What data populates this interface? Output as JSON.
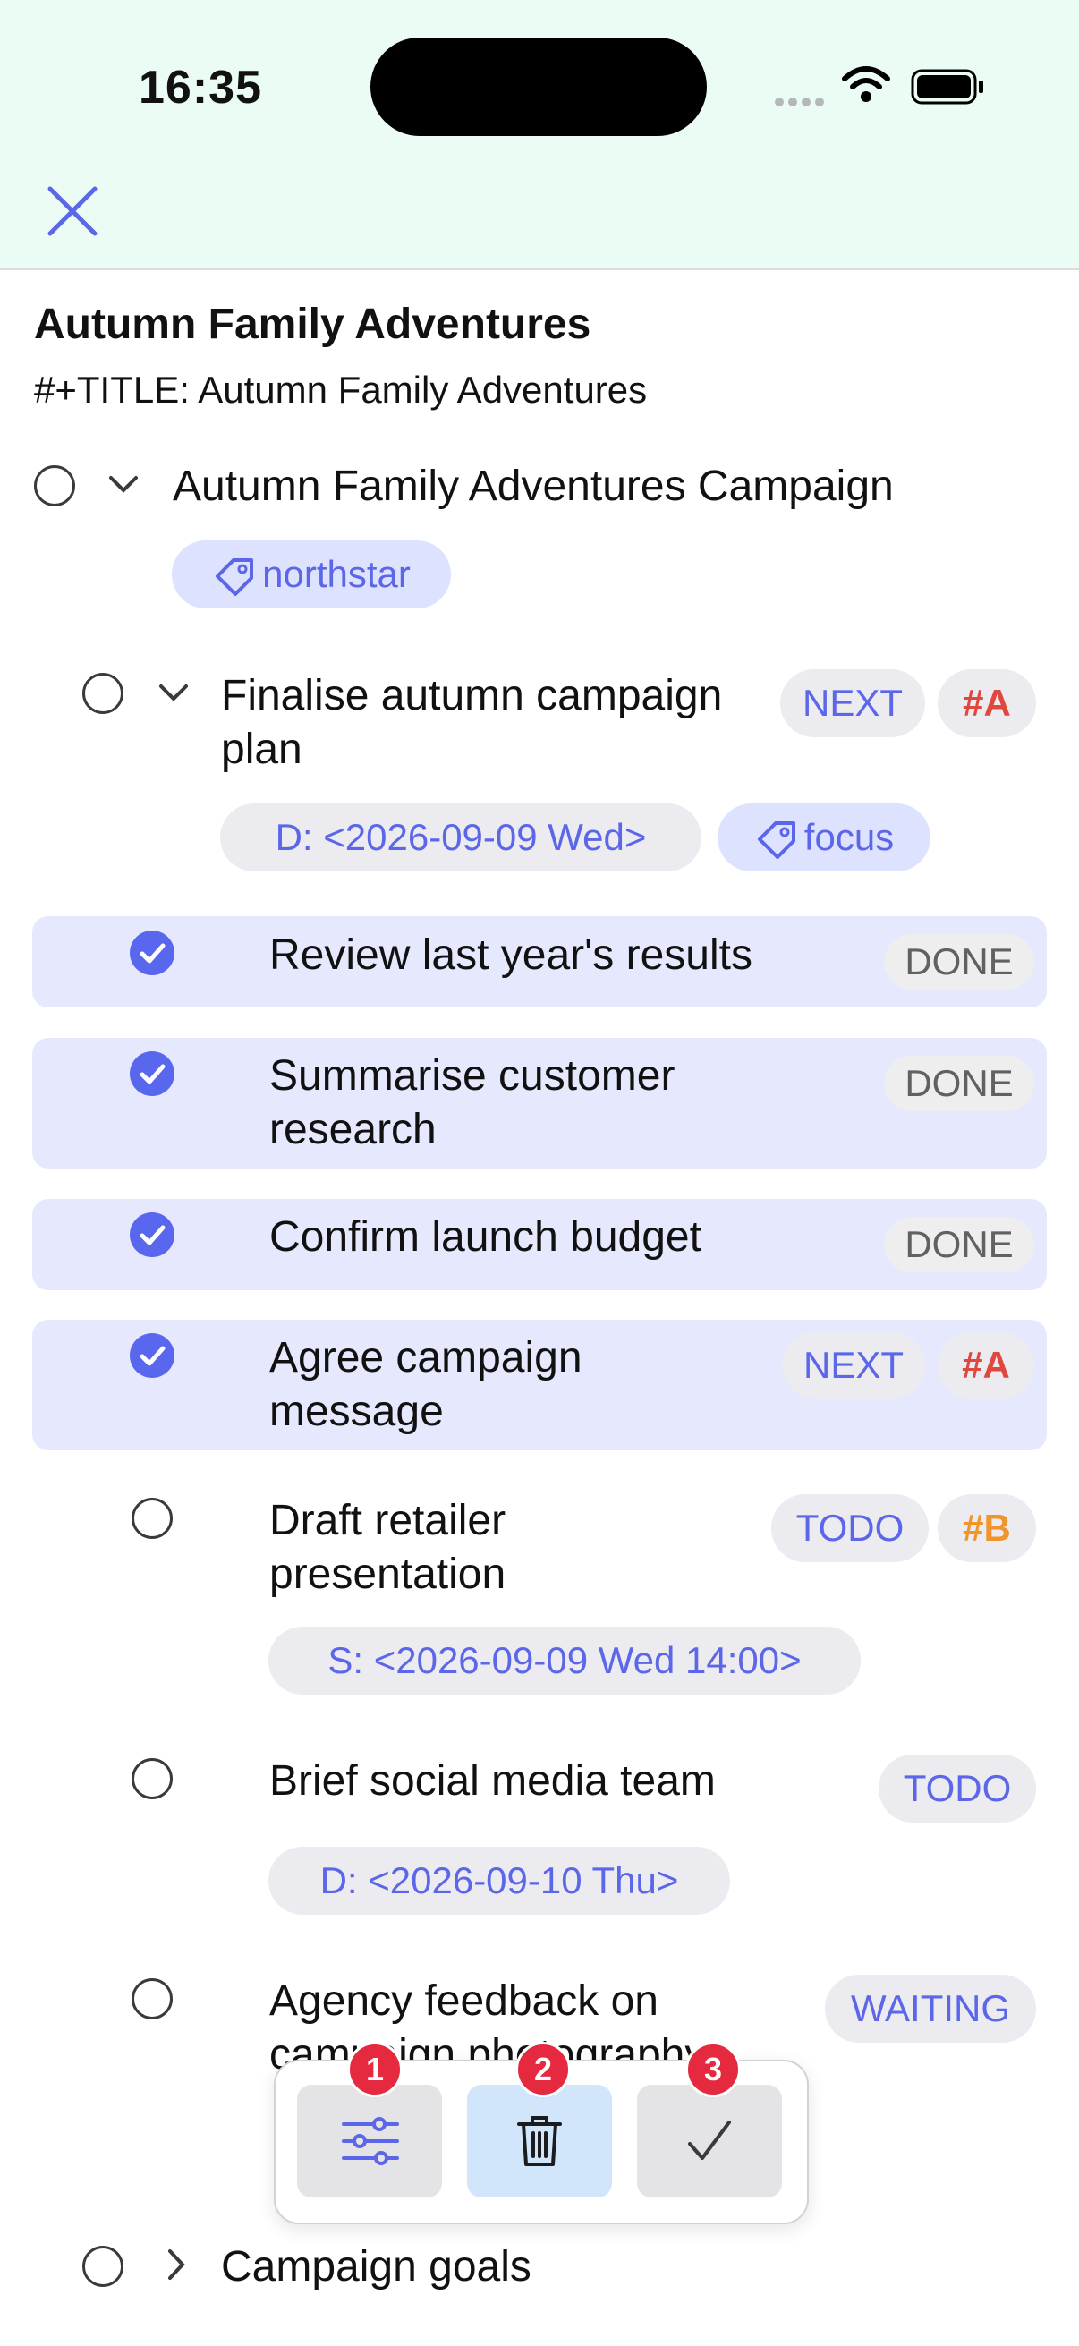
{
  "status_bar": {
    "time": "16:35"
  },
  "document": {
    "title": "Autumn Family Adventures",
    "file_title": "#+TITLE: Autumn Family Adventures"
  },
  "outline": {
    "root": {
      "text": "Autumn Family Adventures Campaign",
      "tag": "northstar"
    },
    "node": {
      "line1": "Finalise autumn campaign",
      "line2": "plan",
      "keyword": "NEXT",
      "priority": "#A",
      "deadline": "D: <2026-09-09 Wed>",
      "tag": "focus"
    },
    "items": [
      {
        "line1": "Review last year's results",
        "line2": "",
        "keyword": "DONE"
      },
      {
        "line1": "Summarise customer",
        "line2": "research",
        "keyword": "DONE"
      },
      {
        "line1": "Confirm launch budget",
        "line2": "",
        "keyword": "DONE"
      },
      {
        "line1": "Agree campaign",
        "line2": "message",
        "keyword": "NEXT",
        "priority": "#A"
      },
      {
        "line1": "Draft retailer",
        "line2": "presentation",
        "keyword": "TODO",
        "priority": "#B",
        "scheduled": "S: <2026-09-09 Wed 14:00>"
      },
      {
        "line1": "Brief social media team",
        "keyword": "TODO",
        "deadline": "D: <2026-09-10 Thu>"
      },
      {
        "line1": "Agency feedback on",
        "line2": "campaign photography",
        "keyword": "WAITING"
      }
    ],
    "collapsed": {
      "text": "Campaign goals"
    }
  },
  "toolbar": {
    "buttons": [
      {
        "icon": "sliders-icon",
        "badge": "1"
      },
      {
        "icon": "trash-icon",
        "badge": "2"
      },
      {
        "icon": "checkmark-icon",
        "badge": "3"
      }
    ]
  },
  "colors": {
    "accent": "#5966ee",
    "highlight": "#e6e9fd",
    "priorityA": "#e0483e",
    "priorityB": "#f0942b",
    "header": "#ebfcf4"
  }
}
